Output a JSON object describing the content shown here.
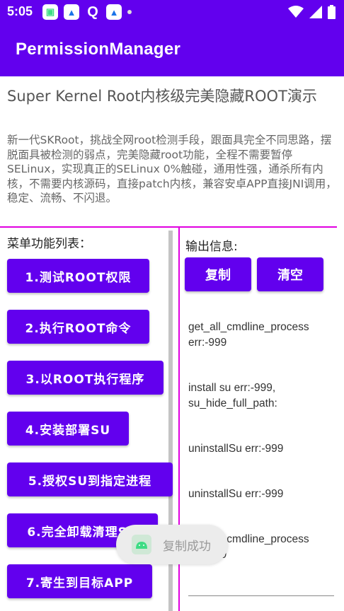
{
  "status_bar": {
    "time": "5:05"
  },
  "app_bar": {
    "title": "PermissionManager"
  },
  "headline": "Super Kernel Root内核级完美隐藏ROOT演示",
  "description": "新一代SKRoot，挑战全网root检测手段，跟面具完全不同思路，摆脱面具被检测的弱点，完美隐藏root功能，全程不需要暂停SELinux，实现真正的SELinux 0%触碰，通用性强，通杀所有内核，不需要内核源码，直接patch内核，兼容安卓APP直接JNI调用，稳定、流畅、不闪退。",
  "menu": {
    "title": "菜单功能列表：",
    "buttons": [
      "1.测试ROOT权限",
      "2.执行ROOT命令",
      "3.以ROOT执行程序",
      "4.安装部署SU",
      "5.授权SU到指定进程",
      "6.完全卸载清理SU",
      "7.寄生到目标APP"
    ]
  },
  "output": {
    "title": "输出信息:",
    "copy_label": "复制",
    "clear_label": "清空",
    "lines": [
      "get_all_cmdline_process err:-999",
      "install su err:-999, su_hide_full_path:",
      "uninstallSu err:-999",
      "uninstallSu err:-999",
      "get_all_cmdline_process err:-999"
    ]
  },
  "toast": {
    "text": "复制成功"
  },
  "colors": {
    "primary": "#6200ee",
    "divider": "#e000e0"
  }
}
